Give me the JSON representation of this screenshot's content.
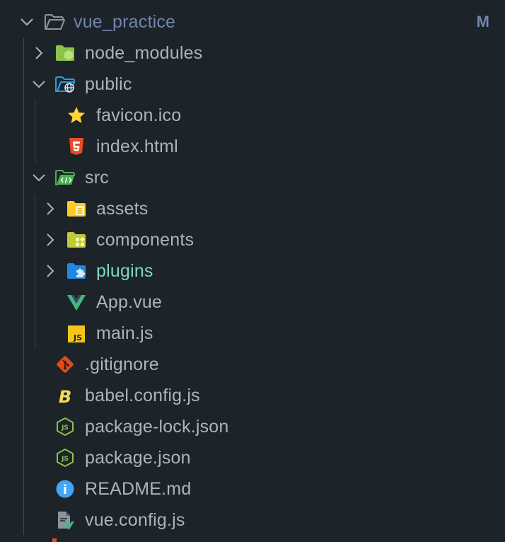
{
  "colors": {
    "background": "#1c2329",
    "label": "#aab4bf",
    "root_label": "#6f86ad",
    "badge": "#6f86ad",
    "plugins_label": "#7ed6c9",
    "guide": "#3d4750"
  },
  "explorer": {
    "root": {
      "name": "vue_practice",
      "badge": "M",
      "icon": "folder-open-icon"
    },
    "items": [
      {
        "name": "node_modules",
        "icon": "nodejs-folder-icon",
        "type": "folder",
        "state": "collapsed"
      },
      {
        "name": "public",
        "icon": "public-folder-icon",
        "type": "folder",
        "state": "expanded"
      },
      {
        "name": "favicon.ico",
        "icon": "star-icon",
        "type": "file"
      },
      {
        "name": "index.html",
        "icon": "html5-icon",
        "type": "file"
      },
      {
        "name": "src",
        "icon": "src-folder-icon",
        "type": "folder",
        "state": "expanded"
      },
      {
        "name": "assets",
        "icon": "assets-folder-icon",
        "type": "folder",
        "state": "collapsed"
      },
      {
        "name": "components",
        "icon": "components-folder-icon",
        "type": "folder",
        "state": "collapsed"
      },
      {
        "name": "plugins",
        "icon": "plugins-folder-icon",
        "type": "folder",
        "state": "collapsed"
      },
      {
        "name": "App.vue",
        "icon": "vue-icon",
        "type": "file"
      },
      {
        "name": "main.js",
        "icon": "javascript-icon",
        "type": "file"
      },
      {
        "name": ".gitignore",
        "icon": "git-icon",
        "type": "file"
      },
      {
        "name": "babel.config.js",
        "icon": "babel-icon",
        "type": "file"
      },
      {
        "name": "package-lock.json",
        "icon": "nodejs-icon",
        "type": "file"
      },
      {
        "name": "package.json",
        "icon": "nodejs-icon",
        "type": "file"
      },
      {
        "name": "README.md",
        "icon": "info-icon",
        "type": "file"
      },
      {
        "name": "vue.config.js",
        "icon": "vue-config-icon",
        "type": "file"
      }
    ],
    "icon_text": {
      "js": "JS",
      "babel": "B",
      "nodejs": "JS",
      "info": "i"
    }
  }
}
